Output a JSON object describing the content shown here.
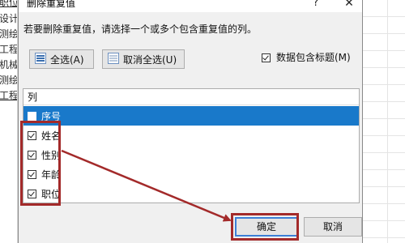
{
  "background": {
    "left_cells": [
      "职位",
      "设计",
      "测绘",
      "工程",
      "机械",
      "测绘",
      "工程"
    ],
    "gridline_color": "#e4e4e4"
  },
  "dialog": {
    "title": "删除重复值",
    "help_glyph": "?",
    "close_glyph": "✕",
    "instruction": "若要删除重复值，请选择一个或多个包含重复值的列。",
    "select_all_label": "全选(A)",
    "unselect_all_label": "取消全选(U)",
    "header_option": {
      "label": "数据包含标题(M)",
      "checked": true
    },
    "columns_header": "列",
    "columns": [
      {
        "label": "序号",
        "checked": false,
        "selected": true
      },
      {
        "label": "姓名",
        "checked": true,
        "selected": false
      },
      {
        "label": "性别",
        "checked": true,
        "selected": false
      },
      {
        "label": "年龄",
        "checked": true,
        "selected": false
      },
      {
        "label": "职位",
        "checked": true,
        "selected": false
      }
    ],
    "ok_label": "确定",
    "cancel_label": "取消"
  },
  "icons": {
    "select_all": "select-all-icon",
    "unselect_all": "unselect-all-icon"
  },
  "colors": {
    "selection": "#1979ca",
    "annotation": "#a32a2a",
    "default_button_border": "#3c7fd6"
  }
}
